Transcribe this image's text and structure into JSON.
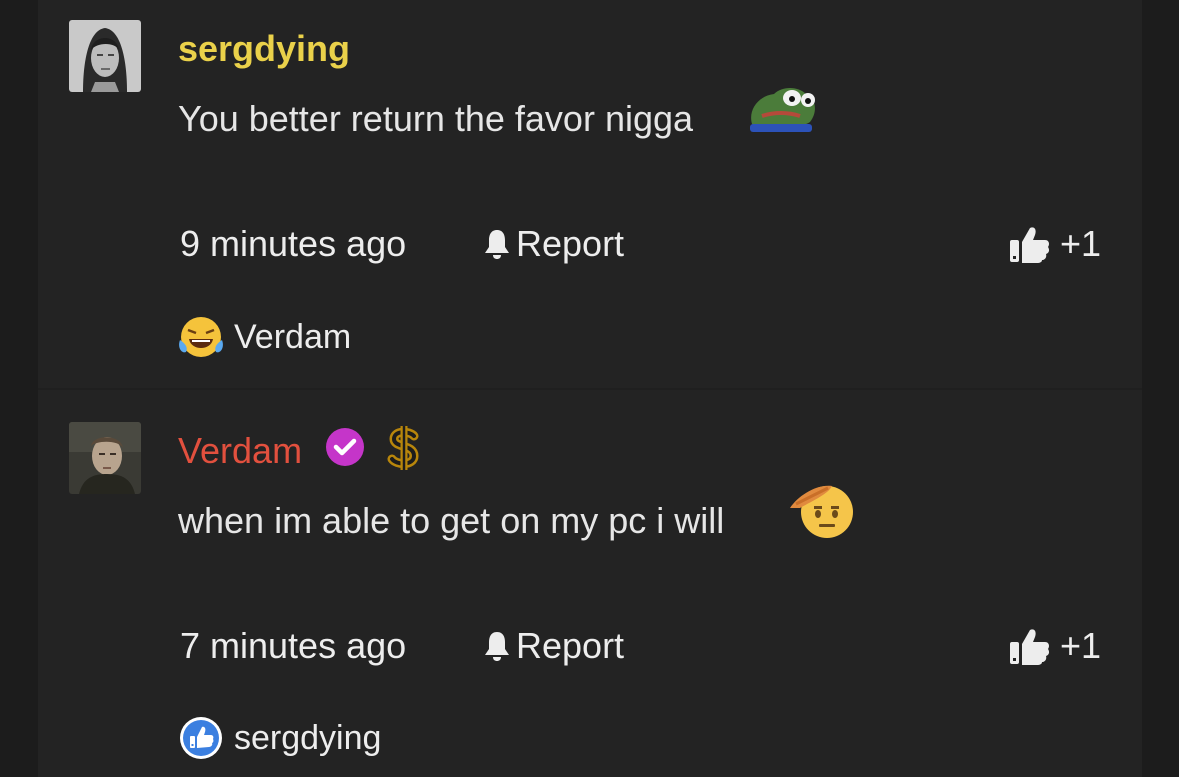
{
  "comments": [
    {
      "username": "sergdying",
      "text": "You better return the favor nigga",
      "time": "9 minutes ago",
      "report_label": "Report",
      "like_count": "+1",
      "reaction_user": "Verdam",
      "reaction_emoji": "joy-tears-emoji",
      "inline_emote": "pepe-frog-emote"
    },
    {
      "username": "Verdam",
      "badges": [
        "verified-check-icon",
        "dollar-sign-icon"
      ],
      "text": "when im able to get on my pc i will",
      "time": "7 minutes ago",
      "report_label": "Report",
      "like_count": "+1",
      "reaction_user": "sergdying",
      "reaction_emoji": "thumbs-up-reaction-icon",
      "inline_emote": "saluting-face-emoji"
    }
  ],
  "colors": {
    "background": "#1c1c1c",
    "panel": "#232323",
    "username_gold": "#ead14a",
    "username_red": "#e2503e",
    "verified_purple": "#c535c9",
    "text": "#e6e6e6"
  }
}
